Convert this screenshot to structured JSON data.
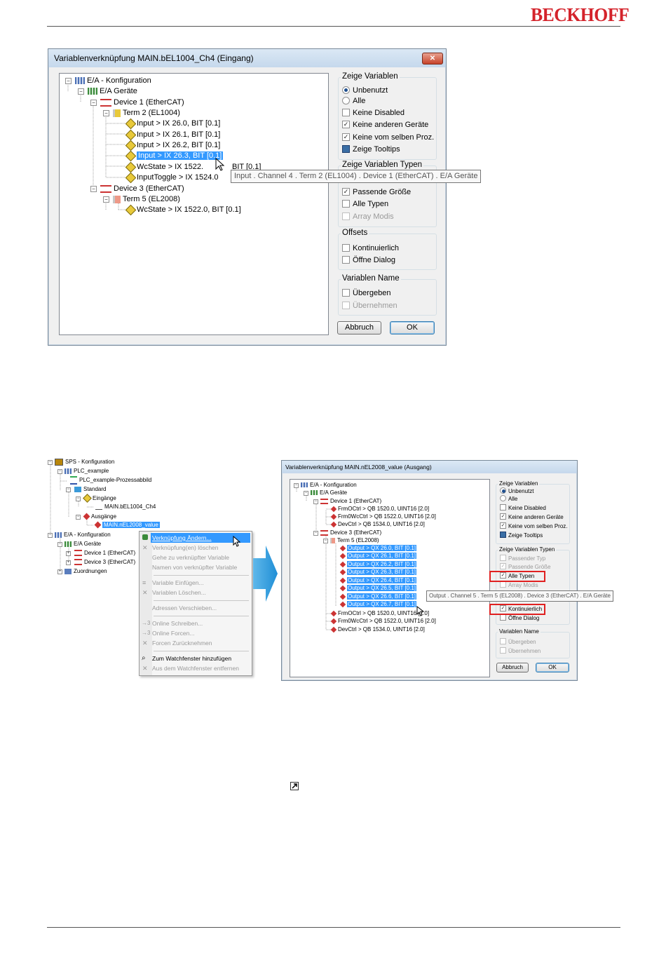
{
  "header": {
    "logo": "BECKHOFF"
  },
  "dialog1": {
    "title": "Variablenverknüpfung MAIN.bEL1004_Ch4 (Eingang)",
    "close_label": "✕",
    "tree": [
      {
        "label": "E/A - Konfiguration"
      },
      {
        "label": "E/A Geräte"
      },
      {
        "label": "Device 1 (EtherCAT)"
      },
      {
        "label": "Term 2 (EL1004)"
      },
      {
        "label": "Input   >   IX 26.0, BIT [0.1]"
      },
      {
        "label": "Input   >   IX 26.1, BIT [0.1]"
      },
      {
        "label": "Input   >   IX 26.2, BIT [0.1]"
      },
      {
        "label": "Input   >   IX 26.3, BIT [0.1]"
      },
      {
        "label": "WcState   >   IX 1522."
      },
      {
        "label": "BIT [0.1]"
      },
      {
        "label": "InputToggle   >   IX 1524.0"
      },
      {
        "label": "Device 3 (EtherCAT)"
      },
      {
        "label": "Term 5 (EL2008)"
      },
      {
        "label": "WcState   >   IX 1522.0, BIT [0.1]"
      }
    ],
    "tooltip": "Input . Channel 4 . Term 2 (EL1004) . Device 1 (EtherCAT) . E/A Geräte",
    "groups": {
      "zeige_variablen": {
        "title": "Zeige Variablen",
        "items": [
          {
            "label": "Unbenutzt",
            "checked": true
          },
          {
            "label": "Alle",
            "checked": false
          },
          {
            "label": "Keine Disabled",
            "checked": false
          },
          {
            "label": "Keine anderen Geräte",
            "checked": true
          },
          {
            "label": "Keine vom selben Proz.",
            "checked": true
          },
          {
            "label": "Zeige Tooltips",
            "checked": true
          }
        ]
      },
      "zeige_typen": {
        "title": "Zeige Variablen Typen",
        "items": [
          {
            "label": "Passende Größe",
            "checked": true
          },
          {
            "label": "Alle Typen",
            "checked": false
          },
          {
            "label": "Array Modis",
            "checked": false
          }
        ]
      },
      "offsets": {
        "title": "Offsets",
        "items": [
          {
            "label": "Kontinuierlich",
            "checked": false
          },
          {
            "label": "Öffne Dialog",
            "checked": false
          }
        ]
      },
      "var_name": {
        "title": "Variablen Name",
        "items": [
          {
            "label": "Übergeben",
            "checked": false
          },
          {
            "label": "Übernehmen",
            "checked": false
          }
        ]
      }
    },
    "buttons": {
      "cancel": "Abbruch",
      "ok": "OK"
    }
  },
  "left_tree": [
    {
      "label": "SPS - Konfiguration"
    },
    {
      "label": "PLC_example"
    },
    {
      "label": "PLC_example-Prozessabbild"
    },
    {
      "label": "Standard"
    },
    {
      "label": "Eingänge"
    },
    {
      "label": "MAIN.bEL1004_Ch4"
    },
    {
      "label": "Ausgänge"
    },
    {
      "label": "MAIN.nEL2008_value"
    },
    {
      "label": "E/A - Konfiguration"
    },
    {
      "label": "E/A Geräte"
    },
    {
      "label": "Device 1 (EtherCAT)"
    },
    {
      "label": "Device 3 (EtherCAT)"
    },
    {
      "label": "Zuordnungen"
    }
  ],
  "context_menu": [
    {
      "label": "Verknüpfung Ändern...",
      "enabled": true
    },
    {
      "label": "Verknüpfung(en) löschen",
      "enabled": false
    },
    {
      "label": "Gehe zu verknüpfter Variable",
      "enabled": false
    },
    {
      "label": "Namen von verknüpfter Variable",
      "enabled": false
    },
    {
      "label": "Variable Einfügen...",
      "enabled": false
    },
    {
      "label": "Variablen Löschen...",
      "enabled": false
    },
    {
      "label": "Adressen Verschieben...",
      "enabled": false
    },
    {
      "label": "Online Schreiben...",
      "enabled": false
    },
    {
      "label": "Online Forcen...",
      "enabled": false
    },
    {
      "label": "Forcen Zurücknehmen",
      "enabled": false
    },
    {
      "label": "Zum Watchfenster hinzufügen",
      "enabled": true
    },
    {
      "label": "Aus dem Watchfenster entfernen",
      "enabled": false
    }
  ],
  "dialog2": {
    "title": "Variablenverknüpfung MAIN.nEL2008_value (Ausgang)",
    "tree": [
      {
        "label": "E/A - Konfiguration"
      },
      {
        "label": "E/A Geräte"
      },
      {
        "label": "Device 1 (EtherCAT)"
      },
      {
        "label": "FrmOCtrl   >   QB 1520.0, UINT16 [2.0]"
      },
      {
        "label": "Frm0WcCtrl   >   QB 1522.0, UINT16 [2.0]"
      },
      {
        "label": "DevCtrl   >   QB 1534.0, UINT16 [2.0]"
      },
      {
        "label": "Device 3 (EtherCAT)"
      },
      {
        "label": "Term 5 (EL2008)"
      },
      {
        "label": "Output   >   QX 26.0, BIT [0.1]"
      },
      {
        "label": "Output   >   QX 26.1, BIT [0.1]"
      },
      {
        "label": "Output   >   QX 26.2, BIT [0.1]"
      },
      {
        "label": "Output   >   QX 26.3, BIT [0.1]"
      },
      {
        "label": "Output   >   QX 26.4, BIT [0.1]"
      },
      {
        "label": "Output   >   QX 26.5, BIT [0.1]"
      },
      {
        "label": "Output   >   QX 26.6, BIT [0.1]"
      },
      {
        "label": "Output   >   QX 26.7, BIT [0.1]"
      },
      {
        "label": "FrmOCtrl   >   QB 1520.0, UINT16 [2.0]"
      },
      {
        "label": "Frm0WcCtrl   >   QB 1522.0, UINT16 [2.0]"
      },
      {
        "label": "DevCtrl   >   QB 1534.0, UINT16 [2.0]"
      }
    ],
    "tooltip": "Output . Channel 5 . Term 5 (EL2008) . Device 3 (EtherCAT) . E/A Geräte",
    "groups": {
      "zeige_variablen": {
        "title": "Zeige Variablen",
        "items": [
          {
            "label": "Unbenutzt",
            "checked": true
          },
          {
            "label": "Alle",
            "checked": false
          },
          {
            "label": "Keine Disabled",
            "checked": false
          },
          {
            "label": "Keine anderen Geräte",
            "checked": true
          },
          {
            "label": "Keine vom selben Proz.",
            "checked": true
          },
          {
            "label": "Zeige Tooltips",
            "checked": true
          }
        ]
      },
      "zeige_typen": {
        "title": "Zeige Variablen Typen",
        "items": [
          {
            "label": "Passender Typ",
            "checked": false
          },
          {
            "label": "Passende Größe",
            "checked": true
          },
          {
            "label": "Alle Typen",
            "checked": true
          },
          {
            "label": "Array Modis",
            "checked": false
          }
        ]
      },
      "offsets": {
        "items": [
          {
            "label": "Kontinuierlich",
            "checked": true
          },
          {
            "label": "Öffne Dialog",
            "checked": false
          }
        ]
      },
      "var_name": {
        "title": "Variablen Name",
        "items": [
          {
            "label": "Übergeben",
            "checked": false
          },
          {
            "label": "Übernehmen",
            "checked": false
          }
        ]
      }
    },
    "buttons": {
      "cancel": "Abbruch",
      "ok": "OK"
    }
  }
}
